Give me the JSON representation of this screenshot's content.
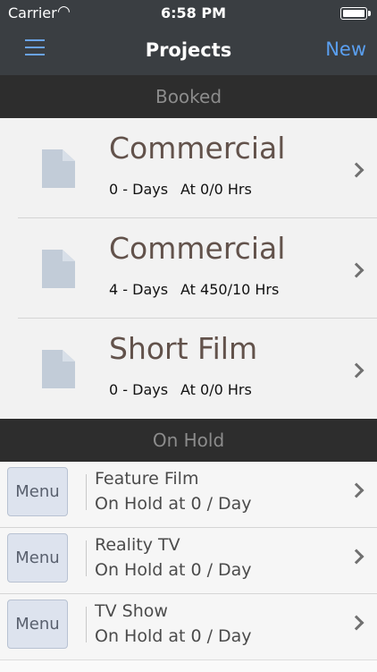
{
  "status_bar": {
    "carrier": "Carrier",
    "wifi_icon": "wifi-icon",
    "time": "6:58 PM"
  },
  "navbar": {
    "title": "Projects",
    "new_label": "New",
    "menu_icon": "hamburger-icon"
  },
  "sections": {
    "booked": "Booked",
    "on_hold": "On Hold"
  },
  "booked_projects": [
    {
      "title": "Commercial",
      "days": "0 - Days",
      "rate": "At 0/0 Hrs"
    },
    {
      "title": "Commercial",
      "days": "4 - Days",
      "rate": "At 450/10 Hrs"
    },
    {
      "title": "Short Film",
      "days": "0 - Days",
      "rate": "At 0/0 Hrs"
    }
  ],
  "on_hold_projects": [
    {
      "menu_label": "Menu",
      "title": "Feature Film",
      "status": "On Hold at 0 / Day"
    },
    {
      "menu_label": "Menu",
      "title": "Reality TV",
      "status": "On Hold at 0 / Day"
    },
    {
      "menu_label": "Menu",
      "title": "TV Show",
      "status": "On Hold at 0 / Day"
    }
  ],
  "colors": {
    "navbar_bg": "#3a3e42",
    "accent": "#5a9ff0",
    "section_bg": "#2d2d2d",
    "title_text": "#62524b"
  }
}
